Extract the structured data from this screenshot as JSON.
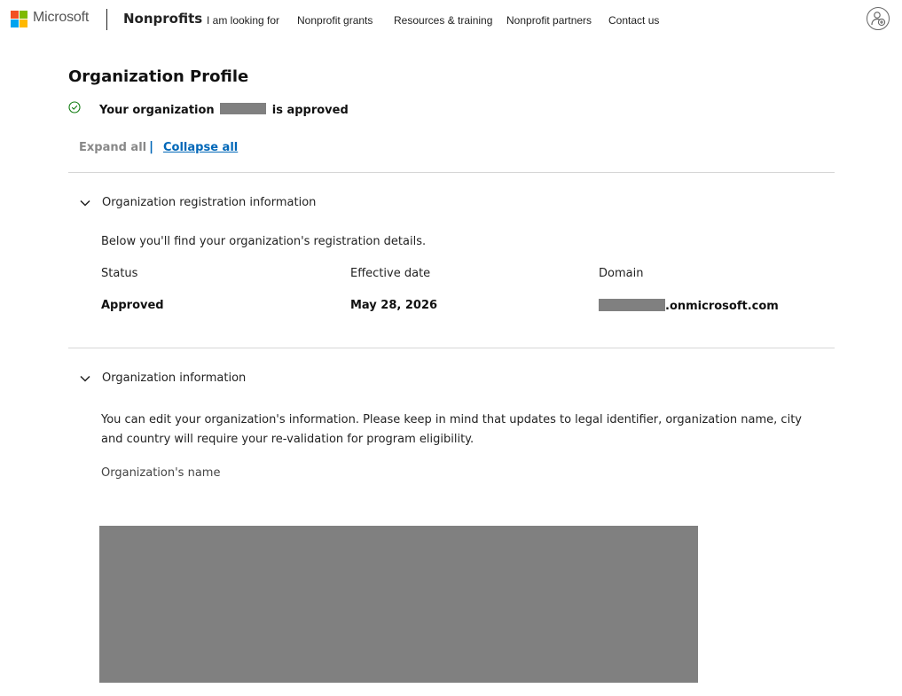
{
  "header": {
    "brand": "Microsoft",
    "site_title": "Nonprofits",
    "nav": [
      {
        "label": "I am looking for"
      },
      {
        "label": "Nonprofit grants"
      },
      {
        "label": "Resources & training"
      },
      {
        "label": "Nonprofit partners"
      },
      {
        "label": "Contact us"
      }
    ],
    "logo_colors": [
      "#f25022",
      "#7fba00",
      "#00a4ef",
      "#ffb900"
    ]
  },
  "page": {
    "title": "Organization Profile",
    "approval_prefix": "Your organization",
    "approval_suffix": "is approved",
    "expand_all": "Expand all",
    "collapse_all": "Collapse all",
    "separator": "|"
  },
  "registration": {
    "title": "Organization registration information",
    "description": "Below you'll find your organization's registration details.",
    "fields": [
      {
        "label": "Status",
        "value": "Approved"
      },
      {
        "label": "Effective date",
        "value": "May 28, 2026"
      },
      {
        "label": "Domain",
        "value_suffix": ".onmicrosoft.com"
      }
    ]
  },
  "org_info": {
    "title": "Organization information",
    "description": "You can edit your organization's information. Please keep in mind that updates to legal identifier, organization name, city and country will require your re-validation for program eligibility.",
    "name_label": "Organization's name"
  },
  "colors": {
    "accent": "#0067b8",
    "success": "#107c10",
    "redaction": "#808080"
  },
  "icons": {
    "approved": "check-circle-icon",
    "section_toggle": "chevron-down-icon",
    "account": "account-add-icon"
  }
}
